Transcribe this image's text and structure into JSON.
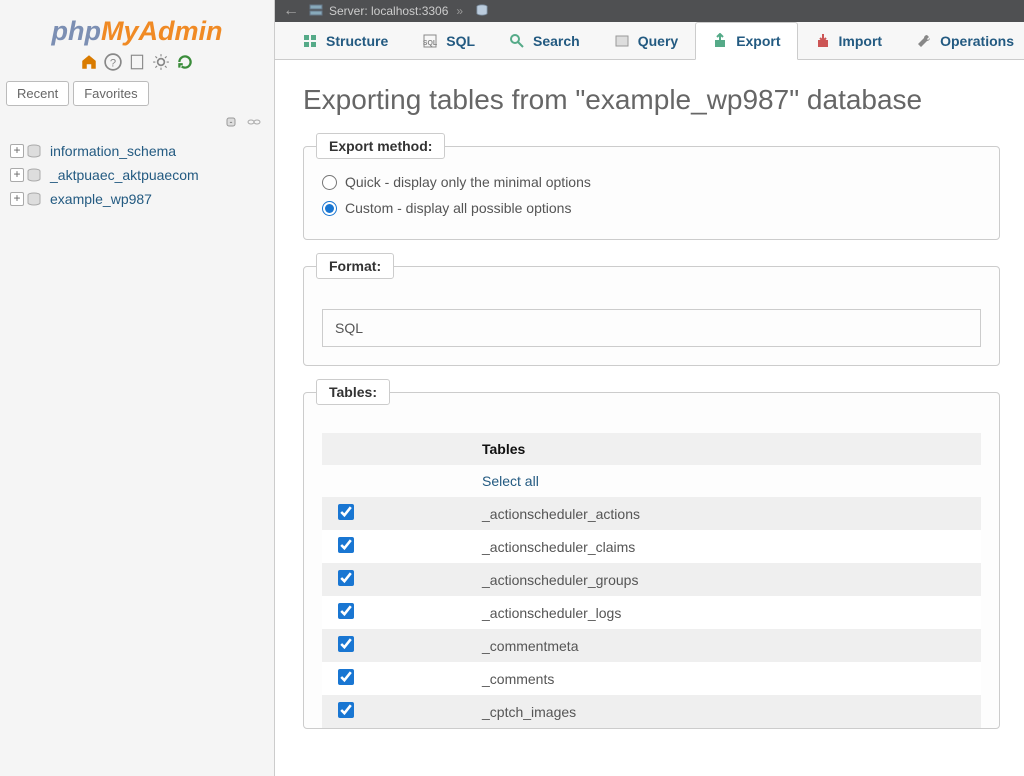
{
  "logo": {
    "part1": "php",
    "part2": "MyAdmin"
  },
  "sidebar": {
    "tabs": {
      "recent": "Recent",
      "favorites": "Favorites"
    },
    "databases": [
      {
        "name": "information_schema"
      },
      {
        "name": "_aktpuaec_aktpuaecom"
      },
      {
        "name": "example_wp987"
      }
    ]
  },
  "topbar": {
    "server_label": "Server: localhost:3306"
  },
  "tabs": {
    "structure": "Structure",
    "sql": "SQL",
    "search": "Search",
    "query": "Query",
    "export": "Export",
    "import": "Import",
    "operations": "Operations"
  },
  "page": {
    "title": "Exporting tables from \"example_wp987\" database"
  },
  "export_method": {
    "legend": "Export method:",
    "quick": "Quick - display only the minimal options",
    "custom": "Custom - display all possible options"
  },
  "format": {
    "legend": "Format:",
    "value": "SQL"
  },
  "tables_section": {
    "legend": "Tables:",
    "header": "Tables",
    "select_all": "Select all",
    "rows": [
      {
        "checked": true,
        "name": "_actionscheduler_actions"
      },
      {
        "checked": true,
        "name": "_actionscheduler_claims"
      },
      {
        "checked": true,
        "name": "_actionscheduler_groups"
      },
      {
        "checked": true,
        "name": "_actionscheduler_logs"
      },
      {
        "checked": true,
        "name": "_commentmeta"
      },
      {
        "checked": true,
        "name": "_comments"
      },
      {
        "checked": true,
        "name": "_cptch_images"
      }
    ]
  }
}
